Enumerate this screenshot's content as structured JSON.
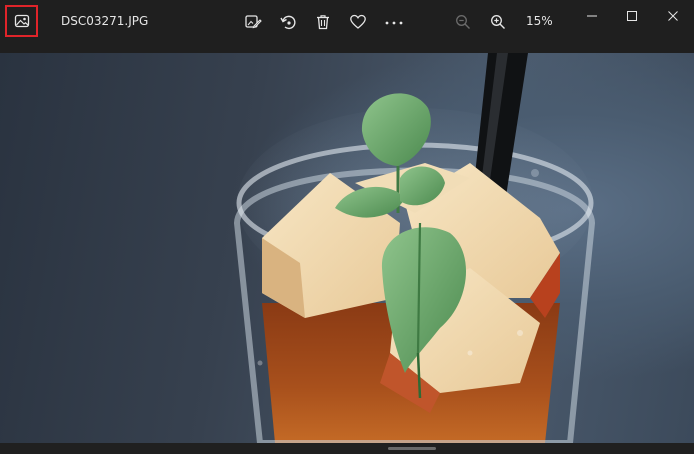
{
  "window": {
    "filename": "DSC03271.JPG",
    "zoom_level": "15%"
  },
  "toolbar": {
    "icons": [
      "photos-app-icon",
      "edit-image-icon",
      "rotate-icon",
      "delete-icon",
      "favorite-heart-icon",
      "more-options-icon",
      "zoom-out-icon",
      "zoom-in-icon"
    ]
  },
  "window_controls": [
    "minimize-icon",
    "maximize-icon",
    "close-icon"
  ],
  "image": {
    "subject": "glass of iced tea with apple slices, mint and a black straw"
  },
  "colors": {
    "titlebar_bg": "#1f1f1f",
    "highlight_border": "#e0242a",
    "text": "#e6e6e6"
  }
}
